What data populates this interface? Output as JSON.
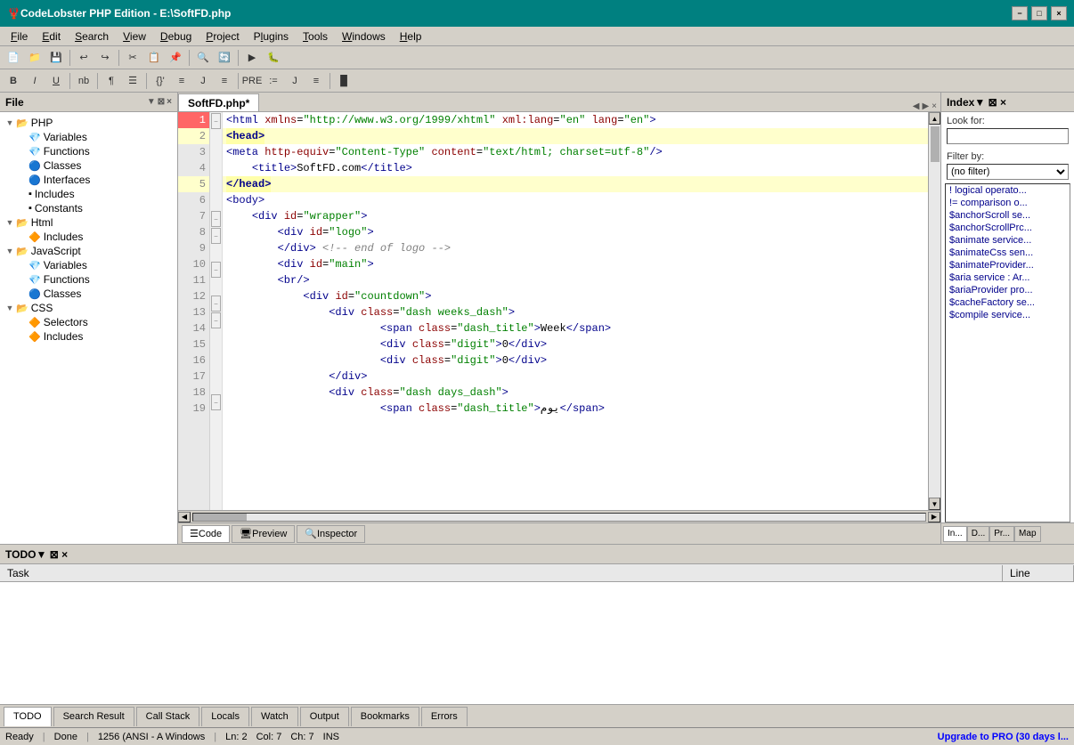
{
  "titleBar": {
    "title": "CodeLobster PHP Edition - E:\\SoftFD.php",
    "icon": "🦞",
    "controls": [
      "−",
      "□",
      "×"
    ]
  },
  "menuBar": {
    "items": [
      "File",
      "Edit",
      "Search",
      "View",
      "Debug",
      "Project",
      "Plugins",
      "Tools",
      "Windows",
      "Help"
    ]
  },
  "filePanel": {
    "title": "File",
    "tree": [
      {
        "label": "PHP",
        "type": "root",
        "expanded": true,
        "indent": 0,
        "icon": "📁"
      },
      {
        "label": "Variables",
        "type": "leaf",
        "indent": 1,
        "icon": "💎"
      },
      {
        "label": "Functions",
        "type": "leaf",
        "indent": 1,
        "icon": "💎"
      },
      {
        "label": "Classes",
        "type": "leaf",
        "indent": 1,
        "icon": "🔵"
      },
      {
        "label": "Interfaces",
        "type": "leaf",
        "indent": 1,
        "icon": "🔵"
      },
      {
        "label": "Includes",
        "type": "leaf",
        "indent": 1,
        "icon": "▪"
      },
      {
        "label": "Constants",
        "type": "leaf",
        "indent": 1,
        "icon": "▪"
      },
      {
        "label": "Html",
        "type": "root",
        "expanded": true,
        "indent": 0,
        "icon": "📁"
      },
      {
        "label": "Includes",
        "type": "leaf",
        "indent": 1,
        "icon": "🔶"
      },
      {
        "label": "JavaScript",
        "type": "root",
        "expanded": true,
        "indent": 0,
        "icon": "📁"
      },
      {
        "label": "Variables",
        "type": "leaf",
        "indent": 1,
        "icon": "💎"
      },
      {
        "label": "Functions",
        "type": "leaf",
        "indent": 1,
        "icon": "💎"
      },
      {
        "label": "Classes",
        "type": "leaf",
        "indent": 1,
        "icon": "🔵"
      },
      {
        "label": "CSS",
        "type": "root",
        "expanded": true,
        "indent": 0,
        "icon": "📁"
      },
      {
        "label": "Selectors",
        "type": "leaf",
        "indent": 1,
        "icon": "🔶"
      },
      {
        "label": "Includes",
        "type": "leaf",
        "indent": 1,
        "icon": "🔶"
      }
    ]
  },
  "editorTab": {
    "filename": "SoftFD.php*",
    "active": true
  },
  "codeLines": [
    {
      "num": 1,
      "text": "<html xmlns=\"http://www.w3.org/1999/xhtml\" xml:lang=\"en\" lang=\"en\">",
      "error": true
    },
    {
      "num": 2,
      "text": "<head>",
      "highlighted": true
    },
    {
      "num": 3,
      "text": "  <meta http-equiv=\"Content-Type\" content=\"text/html; charset=utf-8\"/>"
    },
    {
      "num": 4,
      "text": "    <title>SoftFD.com</title>"
    },
    {
      "num": 5,
      "text": "</head>",
      "highlighted": true
    },
    {
      "num": 6,
      "text": "<body>"
    },
    {
      "num": 7,
      "text": "    <div id=\"wrapper\">"
    },
    {
      "num": 8,
      "text": "        <div id=\"logo\">"
    },
    {
      "num": 9,
      "text": "        </div> <!-- end of logo -->"
    },
    {
      "num": 10,
      "text": "        <div id=\"main\">"
    },
    {
      "num": 11,
      "text": "        <br/>"
    },
    {
      "num": 12,
      "text": "            <div id=\"countdown\">"
    },
    {
      "num": 13,
      "text": "                <div class=\"dash weeks_dash\">"
    },
    {
      "num": 14,
      "text": "                        <span class=\"dash_title\">Week</span>"
    },
    {
      "num": 15,
      "text": "                        <div class=\"digit\">0</div>"
    },
    {
      "num": 16,
      "text": "                        <div class=\"digit\">0</div>"
    },
    {
      "num": 17,
      "text": "                </div>"
    },
    {
      "num": 18,
      "text": "                <div class=\"dash days_dash\">"
    },
    {
      "num": 19,
      "text": "                        <span class=\"dash_title\">يوم</span>"
    }
  ],
  "editorBottomTabs": [
    "Code",
    "Preview",
    "Inspector"
  ],
  "indexPanel": {
    "title": "Index",
    "lookForLabel": "Look for:",
    "filterByLabel": "Filter by:",
    "filterDefault": "(no filter)",
    "items": [
      "! logical operato...",
      "!= comparison o...",
      "$anchorScroll se...",
      "$anchorScrollPrc...",
      "$animate service...",
      "$animateCss sen...",
      "$animateProvider...",
      "$aria service : Ar...",
      "$ariaProvider pro...",
      "$cacheFactory se...",
      "$compile service..."
    ],
    "bottomTabs": [
      "In...",
      "D...",
      "Pr...",
      "Map"
    ]
  },
  "todoPanel": {
    "title": "TODO",
    "columns": [
      "Task",
      "Line"
    ]
  },
  "bottomTabs": [
    "TODO",
    "Search Result",
    "Call Stack",
    "Locals",
    "Watch",
    "Output",
    "Bookmarks",
    "Errors"
  ],
  "statusBar": {
    "ready": "Ready",
    "done": "Done",
    "encoding": "1256 (ANSI - A Windows",
    "position": "Ln: 2",
    "col": "Col: 7",
    "ch": "Ch: 7",
    "mode": "INS",
    "upgrade": "Upgrade to PRO (30 days l..."
  }
}
